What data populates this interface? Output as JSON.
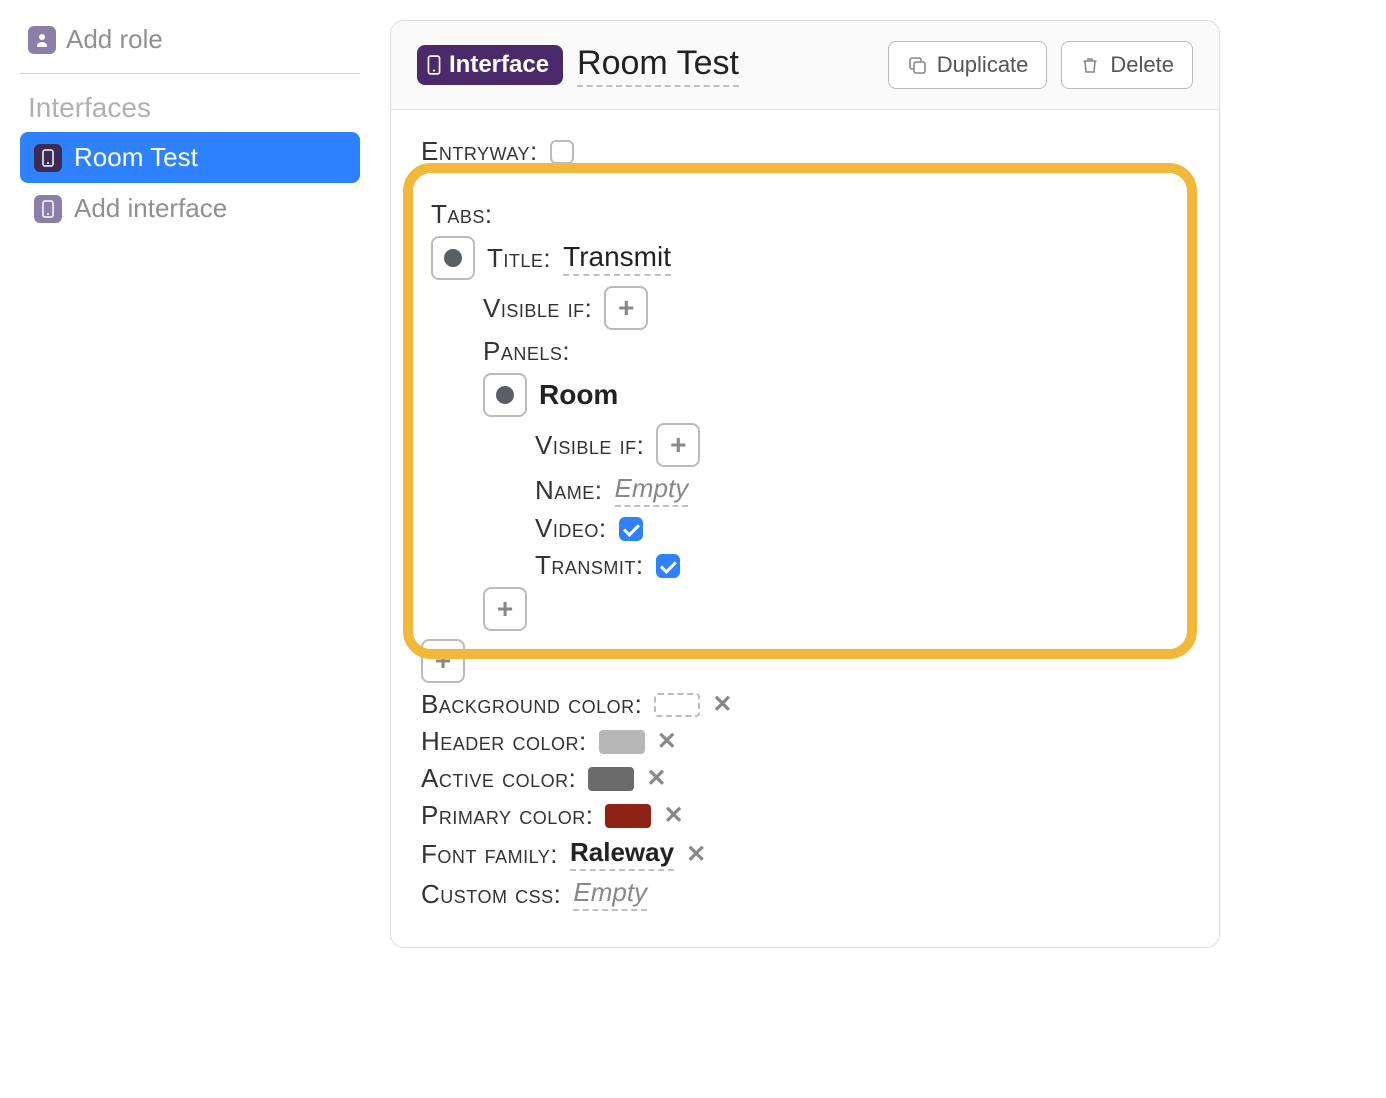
{
  "sidebar": {
    "add_role_label": "Add role",
    "interfaces_heading": "Interfaces",
    "items": [
      {
        "label": "Room Test",
        "active": true
      }
    ],
    "add_interface_label": "Add interface"
  },
  "header": {
    "pill_label": "Interface",
    "title": "Room Test",
    "duplicate_label": "Duplicate",
    "delete_label": "Delete"
  },
  "content": {
    "entryway_label": "Entryway:",
    "entryway_checked": false,
    "tabs_label": "Tabs:",
    "tab": {
      "title_label": "Title:",
      "title_value": "Transmit",
      "visible_if_label": "Visible if:",
      "panels_label": "Panels:",
      "panel": {
        "type_label": "Room",
        "visible_if_label": "Visible if:",
        "name_label": "Name:",
        "name_value": "Empty",
        "video_label": "Video:",
        "video_checked": true,
        "transmit_label": "Transmit:",
        "transmit_checked": true
      }
    },
    "background_color": {
      "label": "Background color:",
      "value": null
    },
    "header_color": {
      "label": "Header color:",
      "value": "#b7b7b7"
    },
    "active_color": {
      "label": "Active color:",
      "value": "#6b6b6b"
    },
    "primary_color": {
      "label": "Primary color:",
      "value": "#8e2214"
    },
    "font_family": {
      "label": "Font family:",
      "value": "Raleway"
    },
    "custom_css": {
      "label": "Custom css:",
      "value": "Empty"
    }
  }
}
